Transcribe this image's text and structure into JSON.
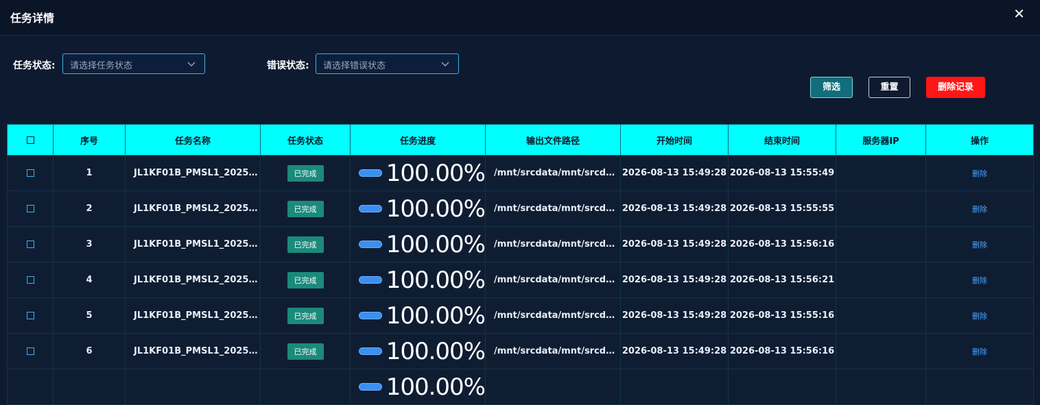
{
  "dialog": {
    "title": "任务详情",
    "close_glyph": "✕"
  },
  "filters": {
    "task_status_label": "任务状态:",
    "task_status_placeholder": "请选择任务状态",
    "error_status_label": "错误状态:",
    "error_status_placeholder": "请选择错误状态"
  },
  "buttons": {
    "filter": "筛选",
    "reset": "重置",
    "delete_records": "删除记录"
  },
  "table": {
    "headers": [
      "序号",
      "任务名称",
      "任务状态",
      "任务进度",
      "输出文件路径",
      "开始时间",
      "结束时间",
      "服务器IP",
      "操作"
    ],
    "rows": [
      {
        "index": "1",
        "name": "JL1KF01B_PMSL1_2025…",
        "status": "已完成",
        "progress": "100.00%",
        "progress_fraction": 1.0,
        "path": "/mnt/srcdata/mnt/srcd…",
        "start": "2026-08-13 15:49:28",
        "end": "2026-08-13 15:55:49",
        "ip": "",
        "action": "删除"
      },
      {
        "index": "2",
        "name": "JL1KF01B_PMSL2_2025…",
        "status": "已完成",
        "progress": "100.00%",
        "progress_fraction": 1.0,
        "path": "/mnt/srcdata/mnt/srcd…",
        "start": "2026-08-13 15:49:28",
        "end": "2026-08-13 15:55:55",
        "ip": "",
        "action": "删除"
      },
      {
        "index": "3",
        "name": "JL1KF01B_PMSL1_2025…",
        "status": "已完成",
        "progress": "100.00%",
        "progress_fraction": 1.0,
        "path": "/mnt/srcdata/mnt/srcd…",
        "start": "2026-08-13 15:49:28",
        "end": "2026-08-13 15:56:16",
        "ip": "",
        "action": "删除"
      },
      {
        "index": "4",
        "name": "JL1KF01B_PMSL2_2025…",
        "status": "已完成",
        "progress": "100.00%",
        "progress_fraction": 1.0,
        "path": "/mnt/srcdata/mnt/srcd…",
        "start": "2026-08-13 15:49:28",
        "end": "2026-08-13 15:56:21",
        "ip": "",
        "action": "删除"
      },
      {
        "index": "5",
        "name": "JL1KF01B_PMSL1_2025…",
        "status": "已完成",
        "progress": "100.00%",
        "progress_fraction": 1.0,
        "path": "/mnt/srcdata/mnt/srcd…",
        "start": "2026-08-13 15:49:28",
        "end": "2026-08-13 15:55:16",
        "ip": "",
        "action": "删除"
      },
      {
        "index": "6",
        "name": "JL1KF01B_PMSL1_2025…",
        "status": "已完成",
        "progress": "100.00%",
        "progress_fraction": 1.0,
        "path": "/mnt/srcdata/mnt/srcd…",
        "start": "2026-08-13 15:49:28",
        "end": "2026-08-13 15:56:16",
        "ip": "",
        "action": "删除"
      },
      {
        "index": "",
        "name": "",
        "status": "",
        "progress": "100.00%",
        "progress_fraction": 1.0,
        "path": "",
        "start": "",
        "end": "",
        "ip": "",
        "action": ""
      }
    ]
  },
  "colors": {
    "header_bg": "#00ffff",
    "status_badge": "#1b8a7c",
    "progress_bar": "#3a8ff0",
    "delete_button": "#ff1616",
    "link": "#4aa3ff"
  },
  "icons": {
    "close": "close-icon",
    "dropdown": "chevron-down-icon",
    "checkbox": "checkbox-icon"
  }
}
